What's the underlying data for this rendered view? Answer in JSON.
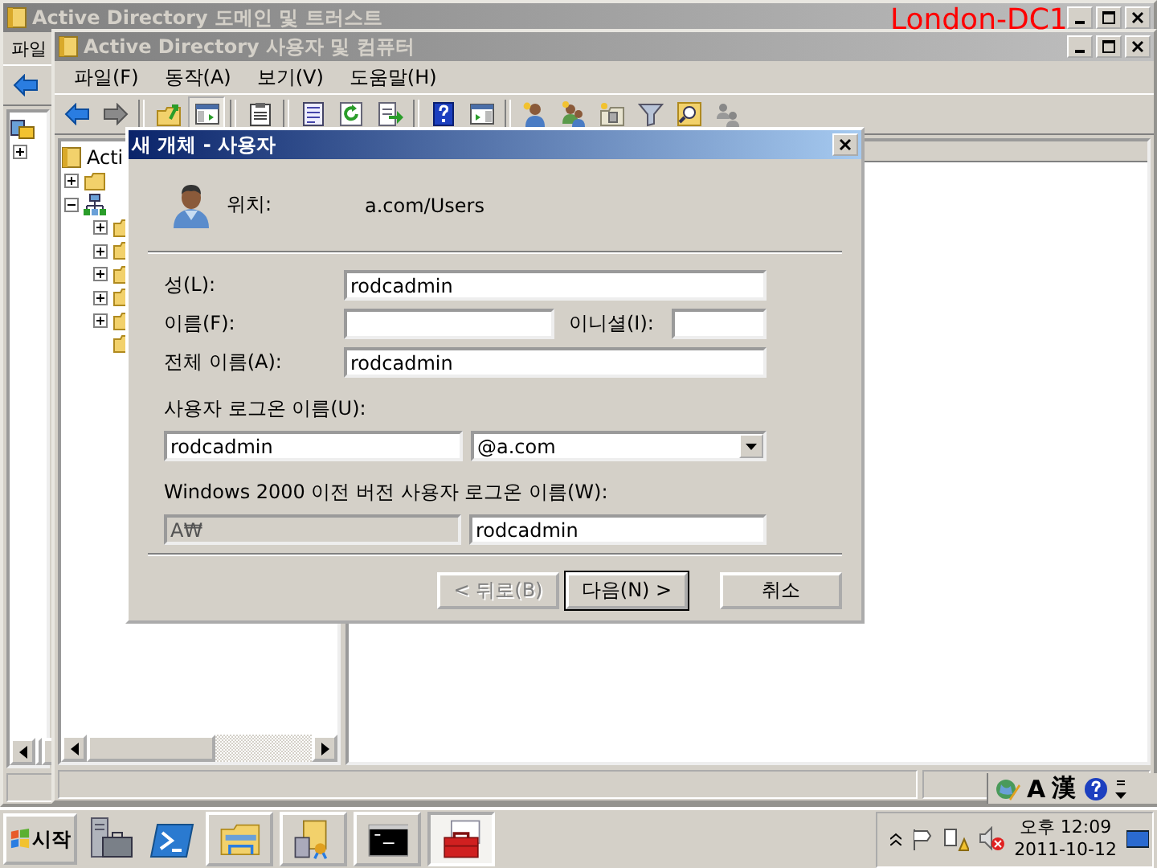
{
  "overlay_label": "London-DC1",
  "back_window": {
    "title": "Active Directory 도메인 및 트러스트",
    "active": false,
    "menu": [
      "파일"
    ],
    "toolbar": [
      {
        "kind": "back",
        "pressed": false
      }
    ],
    "tree": [
      {
        "kind": "domains",
        "children": [
          {
            "expanded": false
          }
        ]
      }
    ]
  },
  "main_window": {
    "title": "Active Directory 사용자 및 컴퓨터",
    "active": false,
    "menu": [
      "파일(F)",
      "동작(A)",
      "보기(V)",
      "도움말(H)"
    ],
    "toolbar": [
      {
        "kind": "back",
        "pressed": false
      },
      {
        "kind": "forward",
        "pressed": false
      },
      {
        "kind": "sep"
      },
      {
        "kind": "up",
        "pressed": false
      },
      {
        "kind": "tree",
        "pressed": true
      },
      {
        "kind": "sep"
      },
      {
        "kind": "clipboard",
        "pressed": false
      },
      {
        "kind": "sep"
      },
      {
        "kind": "properties",
        "pressed": false
      },
      {
        "kind": "refresh",
        "pressed": false
      },
      {
        "kind": "export",
        "pressed": false
      },
      {
        "kind": "sep"
      },
      {
        "kind": "help",
        "pressed": false
      },
      {
        "kind": "panel",
        "pressed": false
      },
      {
        "kind": "sep"
      },
      {
        "kind": "user",
        "pressed": false
      },
      {
        "kind": "group",
        "pressed": false
      },
      {
        "kind": "ou",
        "pressed": false
      },
      {
        "kind": "filter",
        "pressed": false
      },
      {
        "kind": "find",
        "pressed": false
      },
      {
        "kind": "delegate",
        "pressed": false
      }
    ],
    "tree": [
      {
        "kind": "console",
        "label": "Acti",
        "children": [
          {
            "kind": "folder",
            "expanded": false
          },
          {
            "kind": "domain",
            "expanded": true,
            "children": [
              {
                "kind": "folder",
                "expanded": false
              },
              {
                "kind": "folder",
                "expanded": false
              },
              {
                "kind": "folder",
                "expanded": false
              },
              {
                "kind": "folder",
                "expanded": false
              },
              {
                "kind": "folder",
                "expanded": false
              },
              {
                "kind": "folder"
              }
            ]
          }
        ]
      }
    ]
  },
  "dialog": {
    "title": "새 개체 - 사용자",
    "active": true,
    "location_label": "위치:",
    "location_value": "a.com/Users",
    "last_name": {
      "label": "성(L):",
      "value": "rodcadmin"
    },
    "first_name": {
      "label": "이름(F):"
    },
    "initials": {
      "label": "이니셜(I):"
    },
    "full_name": {
      "label": "전체 이름(A):",
      "value": "rodcadmin"
    },
    "logon_name": {
      "label": "사용자 로그온 이름(U):",
      "value": "rodcadmin",
      "domain": "@a.com"
    },
    "pre2000_logon": {
      "label": "Windows 2000 이전 버전 사용자 로그온 이름(W):",
      "domain": "A₩",
      "domain_disabled": true,
      "value": "rodcadmin"
    },
    "buttons": [
      {
        "label": "< 뒤로(B)",
        "disabled": true,
        "default": false
      },
      {
        "label": "다음(N) >",
        "disabled": false,
        "default": true
      },
      {
        "label": "취소",
        "disabled": false,
        "default": false
      }
    ]
  },
  "language_bar": {
    "mode": "A",
    "hanja": "漢"
  },
  "taskbar": {
    "start": "시작",
    "quick_launch": [
      {
        "kind": "server"
      },
      {
        "kind": "powershell"
      }
    ],
    "tasks": [
      {
        "kind": "explorer",
        "selected": false
      },
      {
        "kind": "domains",
        "selected": false
      },
      {
        "kind": "cmd",
        "selected": false
      },
      {
        "kind": "toolbox",
        "selected": true
      }
    ],
    "clock_time": "오후 12:09",
    "clock_date": "2011-10-12"
  }
}
